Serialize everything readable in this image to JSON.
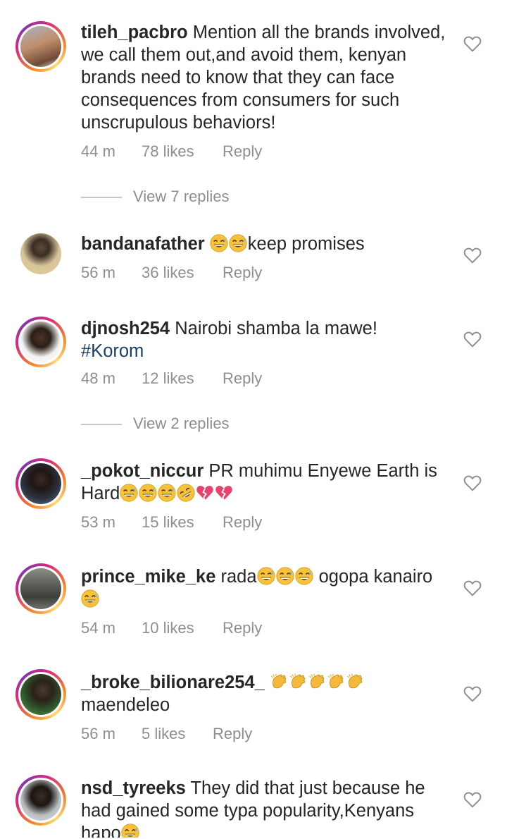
{
  "comments": [
    {
      "username": "tileh_pacbro",
      "text": "Mention all the brands involved, we call them out,and avoid them, kenyan brands need to know that they can face consequences from consumers for such unscrupulous behaviors!",
      "time": "44 m",
      "likes": "78 likes",
      "reply": "Reply",
      "view_replies": "View 7 replies"
    },
    {
      "username": "bandanafather",
      "text": "keep promises",
      "emoji_prefix": [
        "grin-sweat",
        "grin-sweat"
      ],
      "time": "56 m",
      "likes": "36 likes",
      "reply": "Reply"
    },
    {
      "username": "djnosh254",
      "text": "Nairobi shamba la mawe!",
      "hashtag": "#Korom",
      "time": "48 m",
      "likes": "12 likes",
      "reply": "Reply",
      "view_replies": "View 2 replies"
    },
    {
      "username": "_pokot_niccur",
      "text": "PR muhimu Enyewe Earth is Hard",
      "emoji_suffix": [
        "grin-sweat",
        "grin-sweat",
        "grin-sweat",
        "rofl",
        "broken-heart",
        "broken-heart"
      ],
      "time": "53 m",
      "likes": "15 likes",
      "reply": "Reply"
    },
    {
      "username": "prince_mike_ke",
      "text_a": "rada",
      "text_b": "ogopa kanairo",
      "time": "54 m",
      "likes": "10 likes",
      "reply": "Reply"
    },
    {
      "username": "_broke_bilionare254_",
      "text": "maendeleo",
      "time": "56 m",
      "likes": "5 likes",
      "reply": "Reply"
    },
    {
      "username": "nsd_tyreeks",
      "text": "They did that just because he had gained some typa popularity,Kenyans hapo"
    }
  ],
  "colors": {
    "hashtag": "#1b3e6b",
    "meta": "#8e8e8e",
    "text": "#262626"
  },
  "icons": {
    "like": "heart-outline-icon"
  }
}
